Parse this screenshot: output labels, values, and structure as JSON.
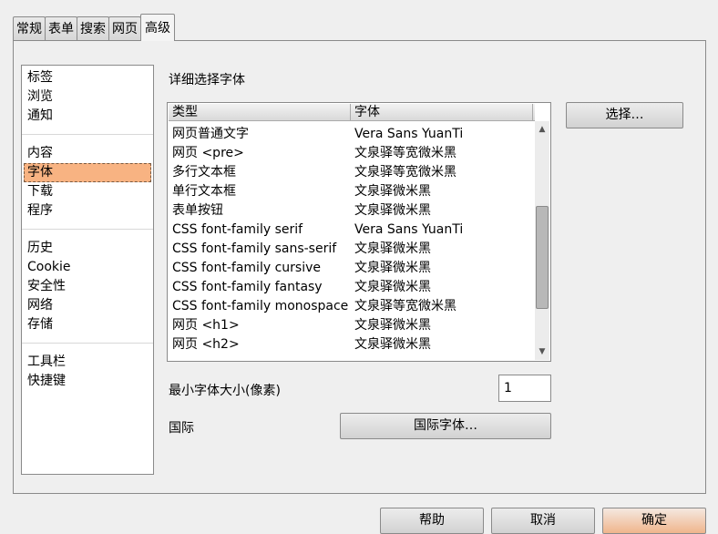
{
  "tabs": [
    {
      "label": "常规"
    },
    {
      "label": "表单"
    },
    {
      "label": "搜索"
    },
    {
      "label": "网页"
    },
    {
      "label": "高级"
    }
  ],
  "categories": {
    "group1": [
      "标签",
      "浏览",
      "通知"
    ],
    "group2": [
      "内容",
      "字体",
      "下载",
      "程序"
    ],
    "group3": [
      "历史",
      "Cookie",
      "安全性",
      "网络",
      "存储"
    ],
    "group4": [
      "工具栏",
      "快捷键"
    ],
    "selected": "字体"
  },
  "fonts": {
    "section_title": "详细选择字体",
    "columns": {
      "type": "类型",
      "font": "字体"
    },
    "rows": [
      {
        "type": "网页普通文字",
        "font": "Vera Sans YuanTi"
      },
      {
        "type": "网页 <pre>",
        "font": "文泉驿等宽微米黑"
      },
      {
        "type": "多行文本框",
        "font": "文泉驿等宽微米黑"
      },
      {
        "type": "单行文本框",
        "font": "文泉驿微米黑"
      },
      {
        "type": "表单按钮",
        "font": "文泉驿微米黑"
      },
      {
        "type": "CSS font-family serif",
        "font": "Vera Sans YuanTi"
      },
      {
        "type": "CSS font-family sans-serif",
        "font": "文泉驿微米黑"
      },
      {
        "type": "CSS font-family cursive",
        "font": "文泉驿微米黑"
      },
      {
        "type": "CSS font-family fantasy",
        "font": "文泉驿微米黑"
      },
      {
        "type": "CSS font-family monospace",
        "font": "文泉驿等宽微米黑"
      },
      {
        "type": "网页 <h1>",
        "font": "文泉驿微米黑"
      },
      {
        "type": "网页 <h2>",
        "font": "文泉驿微米黑"
      }
    ],
    "choose_button": "选择…",
    "min_size_label": "最小字体大小(像素)",
    "min_size_value": "1",
    "intl_label": "国际",
    "intl_button": "国际字体…"
  },
  "dialog_buttons": {
    "help": "帮助",
    "cancel": "取消",
    "ok": "确定"
  }
}
